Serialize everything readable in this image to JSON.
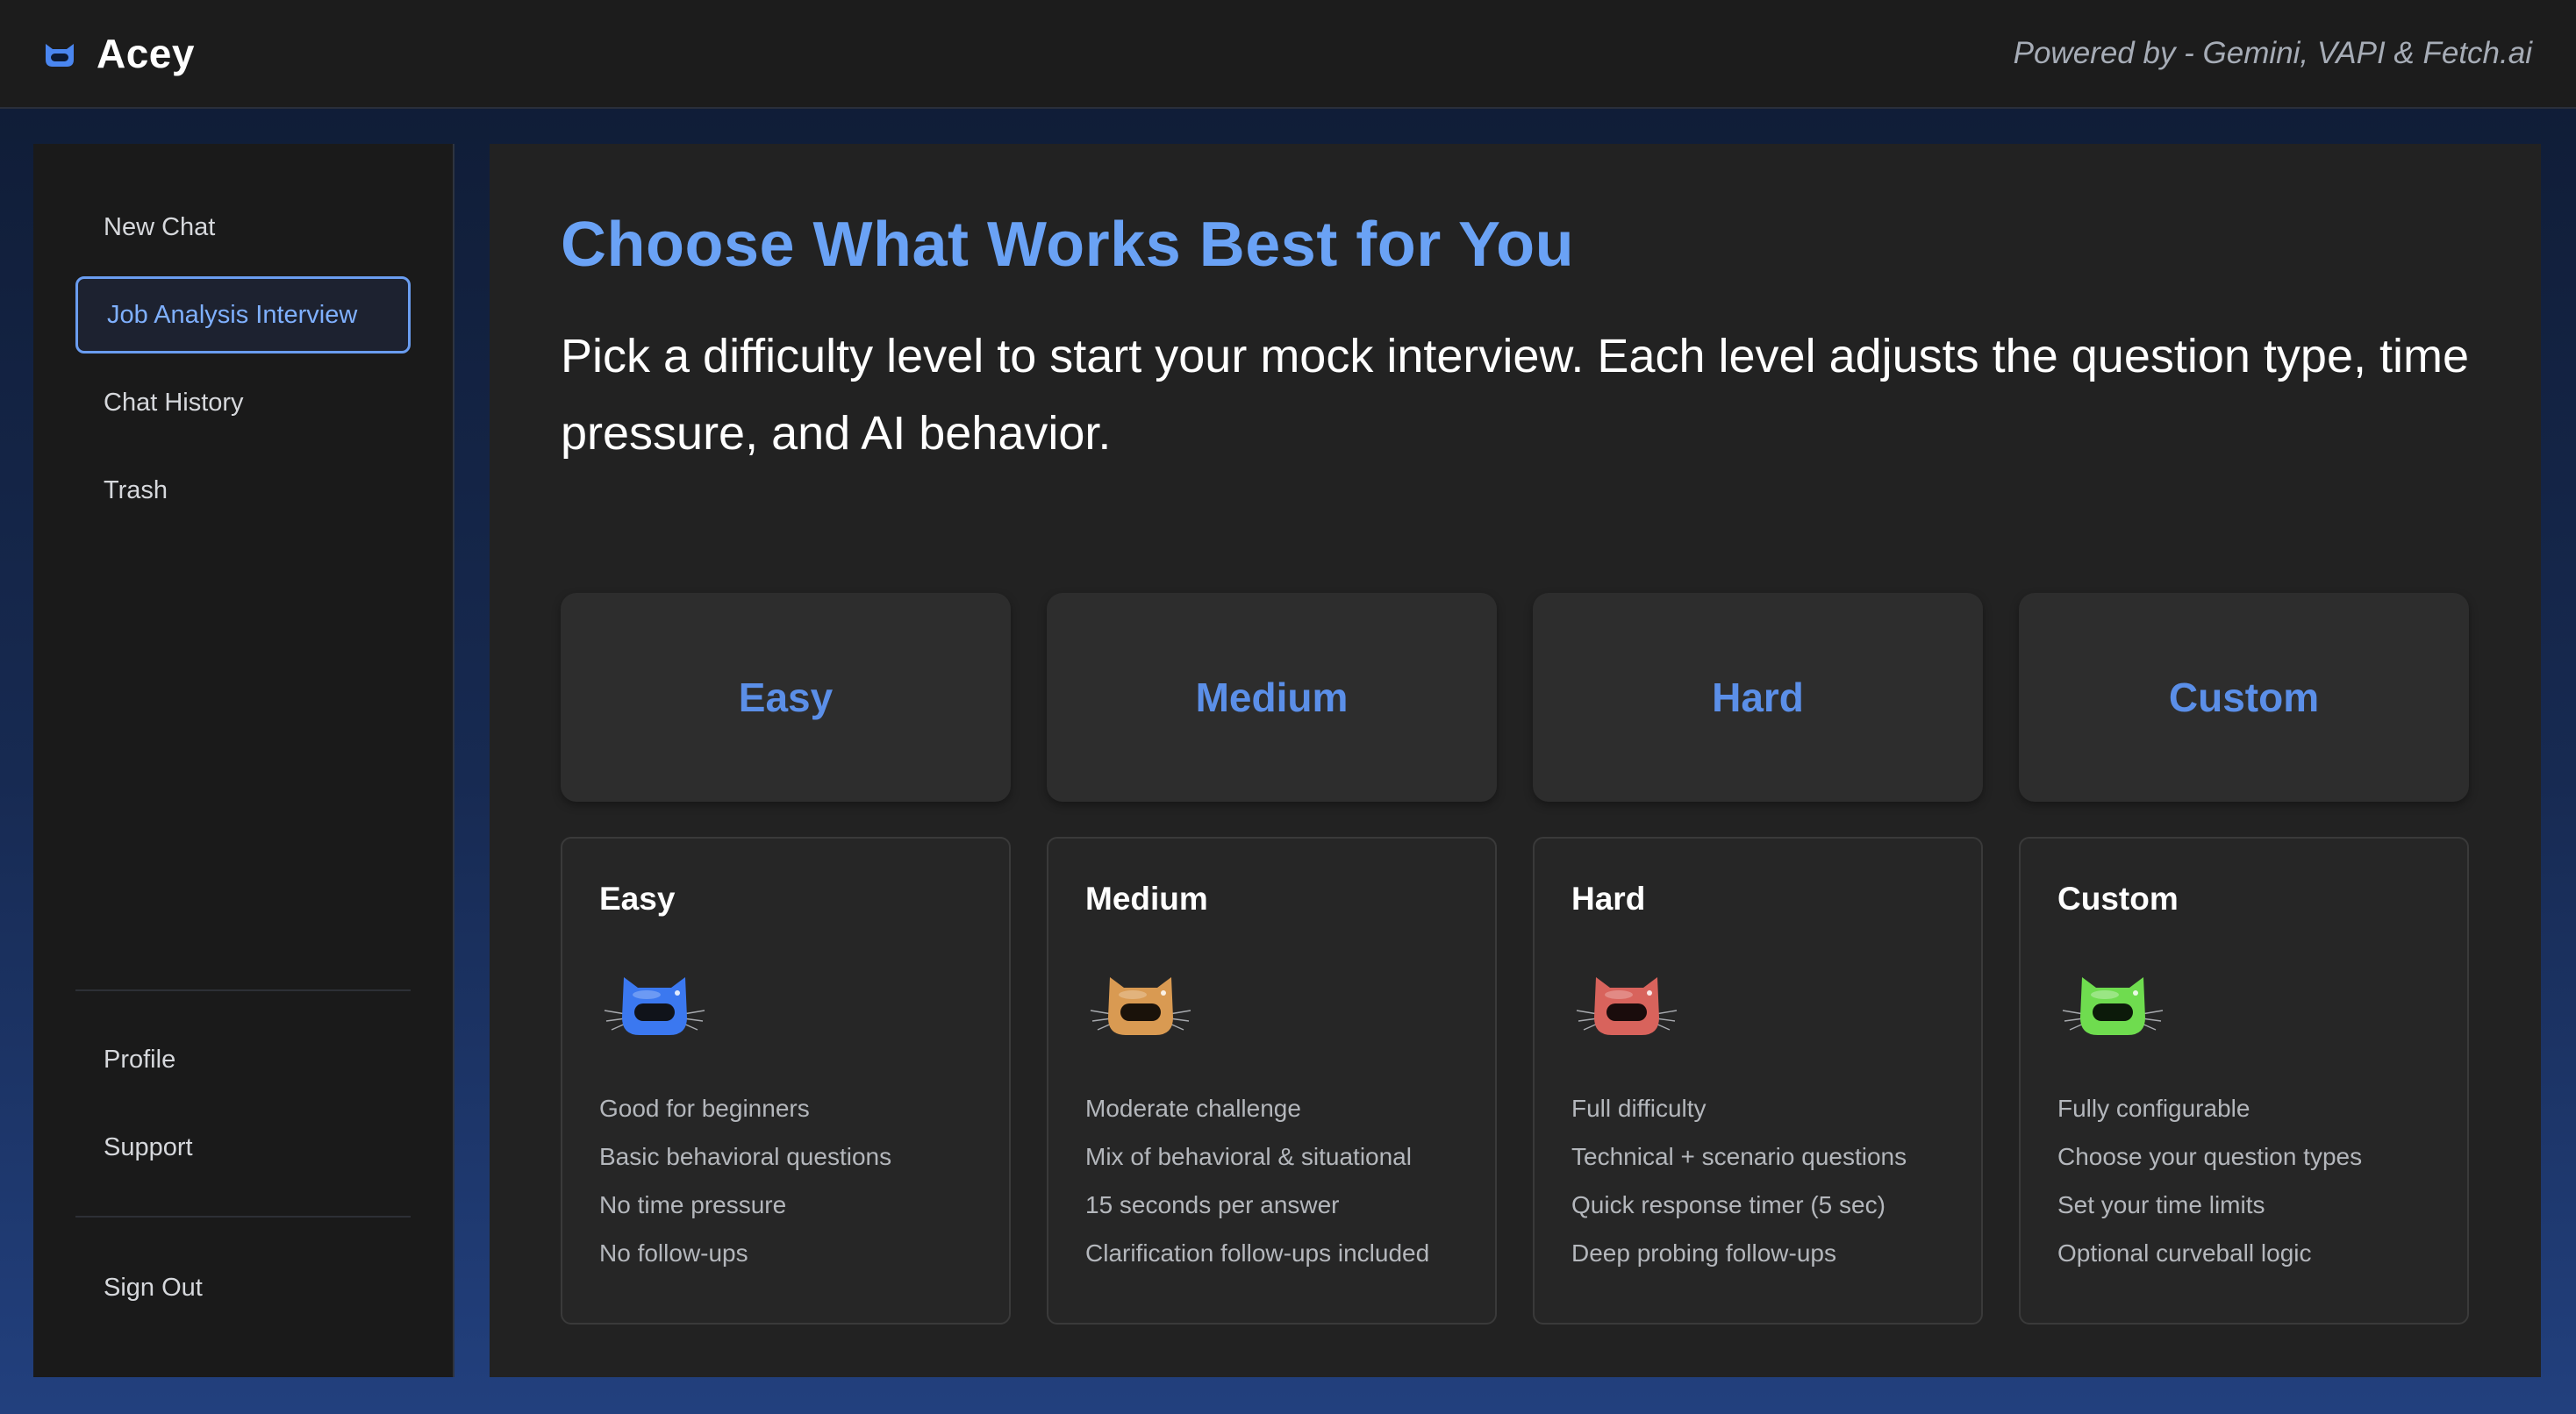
{
  "header": {
    "app_name": "Acey",
    "logo_icon": "cat-face-logo",
    "powered_by": "Powered by - Gemini, VAPI & Fetch.ai"
  },
  "sidebar": {
    "items": [
      {
        "label": "New Chat",
        "active": false
      },
      {
        "label": "Job Analysis Interview",
        "active": true
      },
      {
        "label": "Chat History",
        "active": false
      },
      {
        "label": "Trash",
        "active": false
      }
    ],
    "bottom_items": [
      {
        "label": "Profile"
      },
      {
        "label": "Support"
      }
    ],
    "sign_out_label": "Sign Out"
  },
  "main": {
    "title": "Choose What Works Best for You",
    "subtitle": "Pick a difficulty level to start your mock interview. Each level adjusts the question type, time pressure, and AI behavior.",
    "level_buttons": [
      "Easy",
      "Medium",
      "Hard",
      "Custom"
    ],
    "cards": [
      {
        "title": "Easy",
        "icon": "blue-cat-icon",
        "color": "#3b78f0",
        "features": [
          "Good for beginners",
          "Basic behavioral questions",
          "No time pressure",
          "No follow-ups"
        ]
      },
      {
        "title": "Medium",
        "icon": "orange-cat-icon",
        "color": "#d99a52",
        "features": [
          "Moderate challenge",
          "Mix of behavioral & situational",
          "15 seconds per answer",
          "Clarification follow-ups included"
        ]
      },
      {
        "title": "Hard",
        "icon": "red-cat-icon",
        "color": "#d8635c",
        "features": [
          "Full difficulty",
          "Technical + scenario questions",
          "Quick response timer (5 sec)",
          "Deep probing follow-ups"
        ]
      },
      {
        "title": "Custom",
        "icon": "green-cat-icon",
        "color": "#6fdc4f",
        "features": [
          "Fully configurable",
          "Choose your question types",
          "Set your time limits",
          "Optional curveball logic"
        ]
      }
    ]
  },
  "colors": {
    "accent": "#6aa2f5",
    "button_text": "#5b8fe8",
    "panel": "#222222",
    "sidebar": "#1a1a1a"
  }
}
